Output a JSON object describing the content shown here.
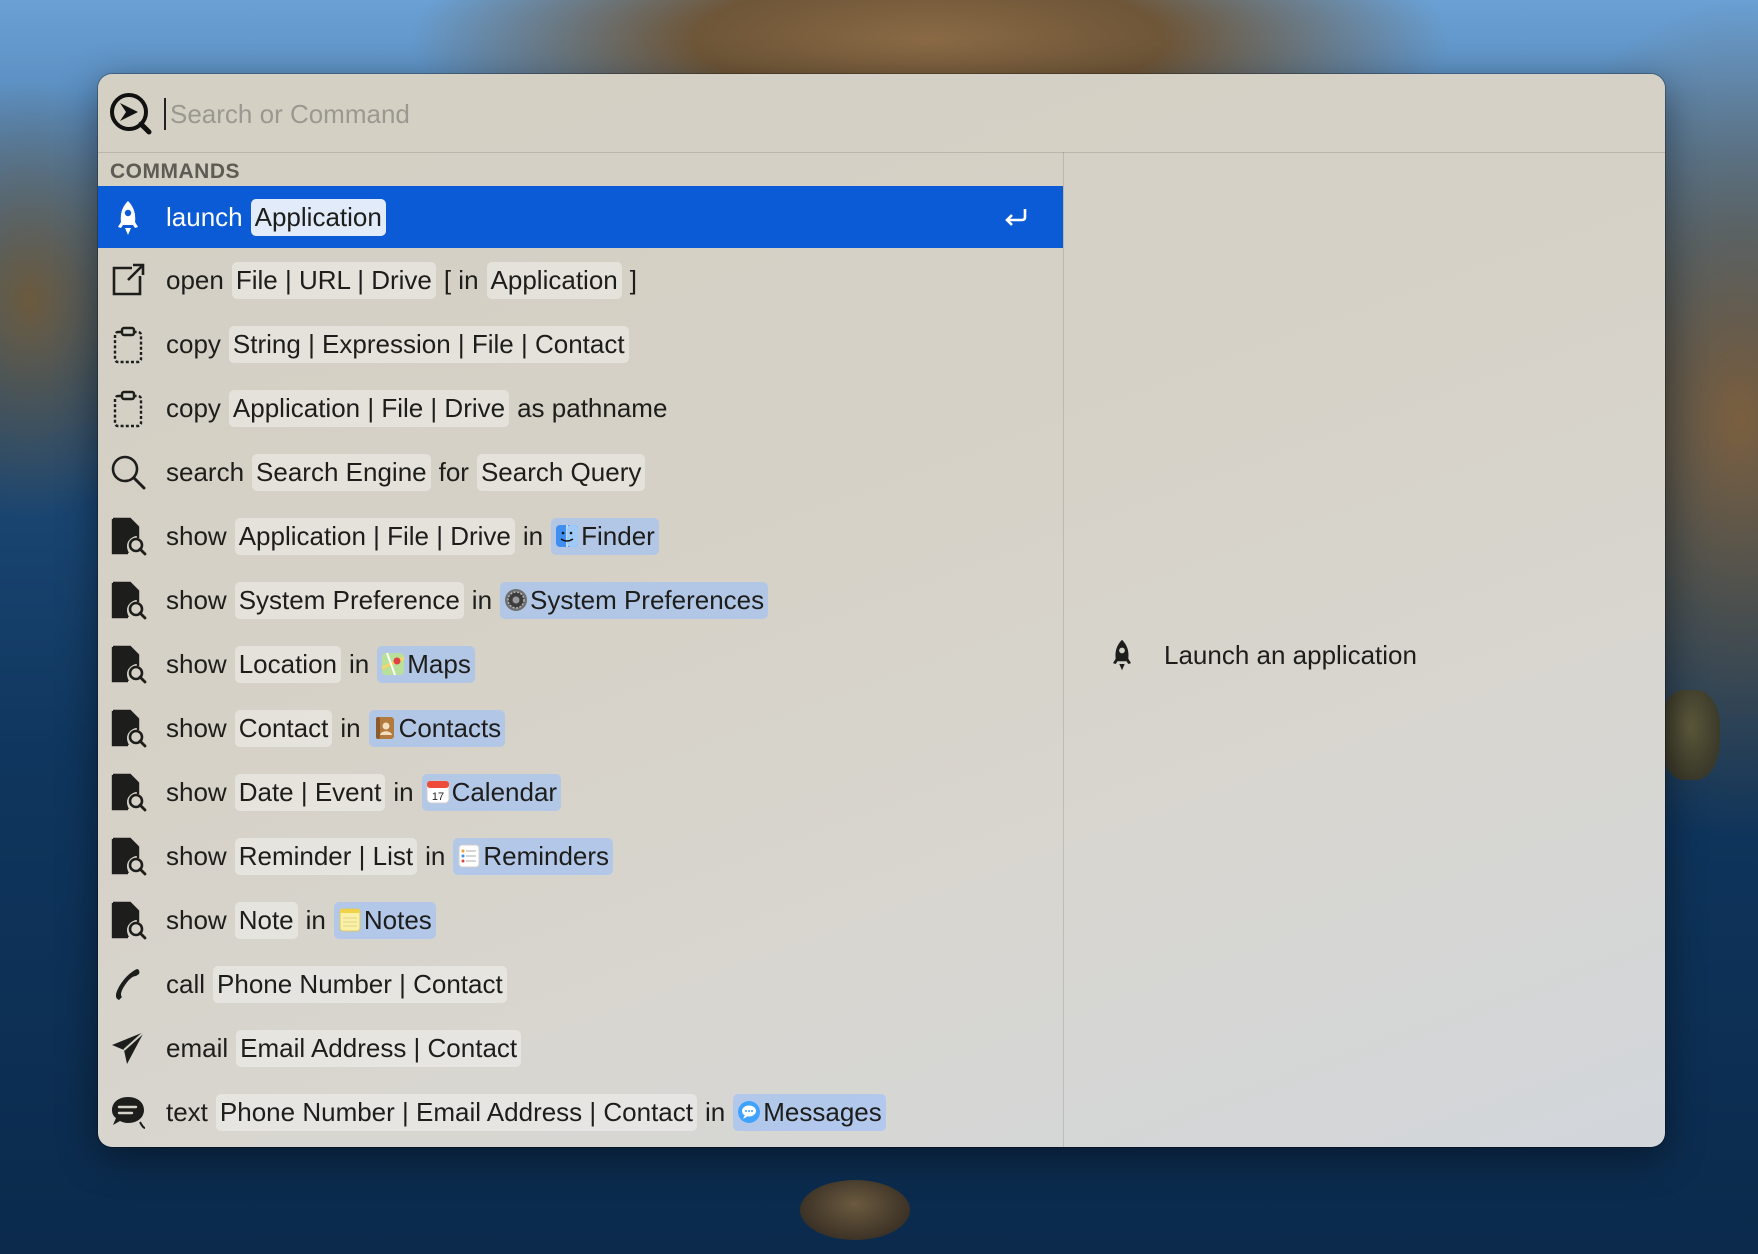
{
  "search": {
    "placeholder": "Search or Command",
    "value": ""
  },
  "section_title": "COMMANDS",
  "commands": [
    {
      "icon": "rocket-icon",
      "selected": true,
      "parts": [
        {
          "t": "kw",
          "v": "launch"
        },
        {
          "t": "token",
          "v": "Application"
        }
      ]
    },
    {
      "icon": "open-external-icon",
      "parts": [
        {
          "t": "kw",
          "v": "open"
        },
        {
          "t": "token",
          "v": "File | URL | Drive"
        },
        {
          "t": "plain",
          "v": "[ in"
        },
        {
          "t": "token",
          "v": "Application"
        },
        {
          "t": "plain",
          "v": "]"
        }
      ]
    },
    {
      "icon": "clipboard-icon",
      "parts": [
        {
          "t": "kw",
          "v": "copy"
        },
        {
          "t": "token",
          "v": "String | Expression | File | Contact"
        }
      ]
    },
    {
      "icon": "clipboard-icon",
      "parts": [
        {
          "t": "kw",
          "v": "copy"
        },
        {
          "t": "token",
          "v": "Application | File | Drive"
        },
        {
          "t": "plain",
          "v": "as pathname"
        }
      ]
    },
    {
      "icon": "magnifier-icon",
      "parts": [
        {
          "t": "kw",
          "v": "search"
        },
        {
          "t": "token",
          "v": "Search Engine"
        },
        {
          "t": "plain",
          "v": "for"
        },
        {
          "t": "token",
          "v": "Search Query"
        }
      ]
    },
    {
      "icon": "document-search-icon",
      "parts": [
        {
          "t": "kw",
          "v": "show"
        },
        {
          "t": "token",
          "v": "Application | File | Drive"
        },
        {
          "t": "plain",
          "v": "in"
        },
        {
          "t": "app",
          "v": "Finder",
          "appicon": "finder-icon"
        }
      ]
    },
    {
      "icon": "document-search-icon",
      "parts": [
        {
          "t": "kw",
          "v": "show"
        },
        {
          "t": "token",
          "v": "System Preference"
        },
        {
          "t": "plain",
          "v": "in"
        },
        {
          "t": "app",
          "v": "System Preferences",
          "appicon": "system-preferences-icon"
        }
      ]
    },
    {
      "icon": "document-search-icon",
      "parts": [
        {
          "t": "kw",
          "v": "show"
        },
        {
          "t": "token",
          "v": "Location"
        },
        {
          "t": "plain",
          "v": "in"
        },
        {
          "t": "app",
          "v": "Maps",
          "appicon": "maps-icon"
        }
      ]
    },
    {
      "icon": "document-search-icon",
      "parts": [
        {
          "t": "kw",
          "v": "show"
        },
        {
          "t": "token",
          "v": "Contact"
        },
        {
          "t": "plain",
          "v": "in"
        },
        {
          "t": "app",
          "v": "Contacts",
          "appicon": "contacts-icon"
        }
      ]
    },
    {
      "icon": "document-search-icon",
      "parts": [
        {
          "t": "kw",
          "v": "show"
        },
        {
          "t": "token",
          "v": "Date | Event"
        },
        {
          "t": "plain",
          "v": "in"
        },
        {
          "t": "app",
          "v": "Calendar",
          "appicon": "calendar-icon"
        }
      ]
    },
    {
      "icon": "document-search-icon",
      "parts": [
        {
          "t": "kw",
          "v": "show"
        },
        {
          "t": "token",
          "v": "Reminder | List"
        },
        {
          "t": "plain",
          "v": "in"
        },
        {
          "t": "app",
          "v": "Reminders",
          "appicon": "reminders-icon"
        }
      ]
    },
    {
      "icon": "document-search-icon",
      "parts": [
        {
          "t": "kw",
          "v": "show"
        },
        {
          "t": "token",
          "v": "Note"
        },
        {
          "t": "plain",
          "v": "in"
        },
        {
          "t": "app",
          "v": "Notes",
          "appicon": "notes-icon"
        }
      ]
    },
    {
      "icon": "phone-icon",
      "parts": [
        {
          "t": "kw",
          "v": "call"
        },
        {
          "t": "token",
          "v": "Phone Number | Contact"
        }
      ]
    },
    {
      "icon": "paper-plane-icon",
      "parts": [
        {
          "t": "kw",
          "v": "email"
        },
        {
          "t": "token",
          "v": "Email Address | Contact"
        }
      ]
    },
    {
      "icon": "chat-bubble-icon",
      "parts": [
        {
          "t": "kw",
          "v": "text"
        },
        {
          "t": "token",
          "v": "Phone Number | Email Address | Contact"
        },
        {
          "t": "plain",
          "v": "in"
        },
        {
          "t": "app",
          "v": "Messages",
          "appicon": "messages-icon"
        }
      ]
    }
  ],
  "preview": {
    "icon": "rocket-icon",
    "text": "Launch an application"
  },
  "colors": {
    "selection": "#0b5ad6",
    "app_token": "#b7cff5",
    "arg_token": "#ecebe6"
  }
}
